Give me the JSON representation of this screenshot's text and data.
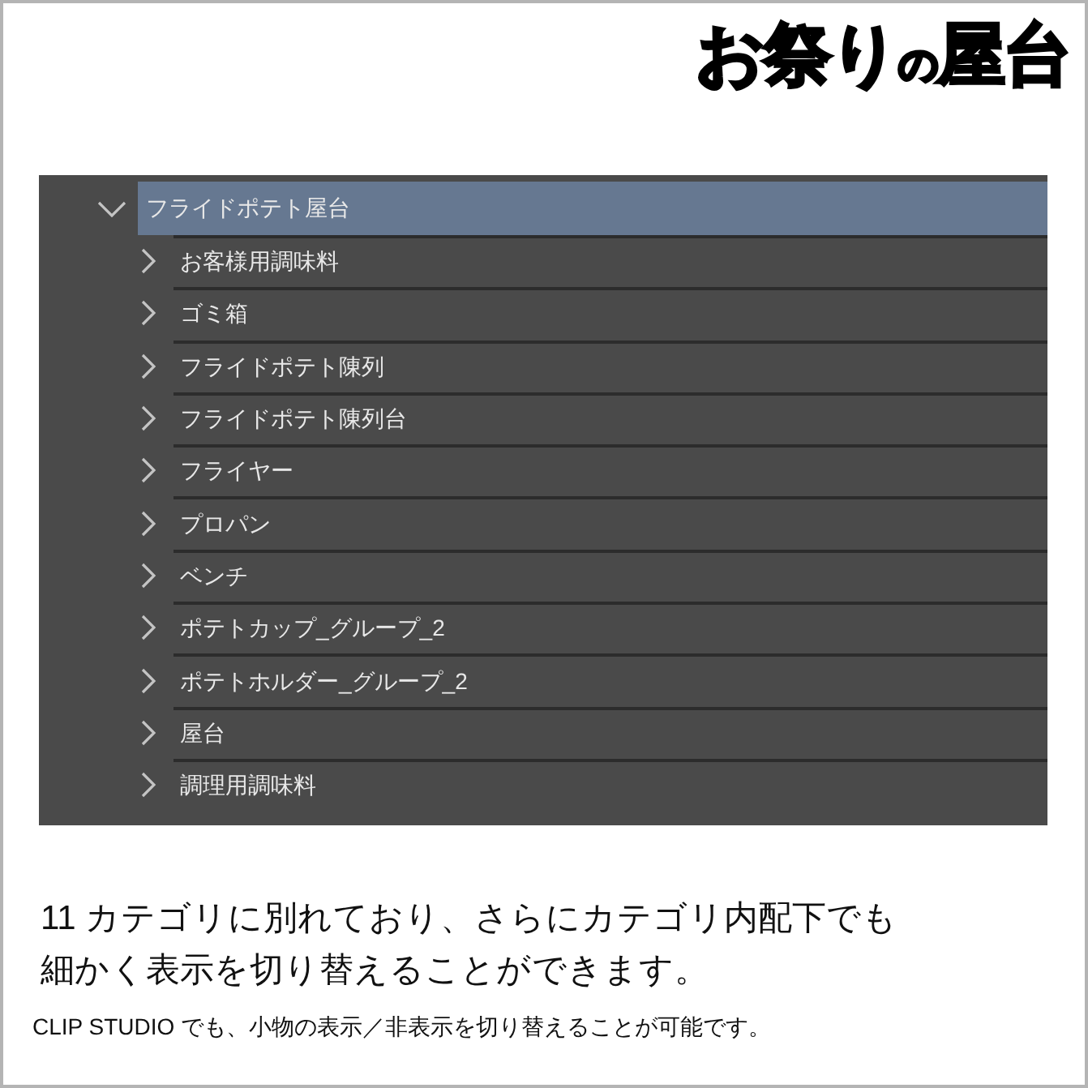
{
  "header": {
    "title": "お祭り$_{の}$屋台"
  },
  "tree": {
    "label": "フライドポテト屋台",
    "expanded": true,
    "selected": true,
    "children": [
      {
        "label": "お客様用調味料",
        "expanded": false,
        "selected": false
      },
      {
        "label": "ゴミ箱",
        "expanded": false,
        "selected": false
      },
      {
        "label": "フライドポテト陳列",
        "expanded": false,
        "selected": false
      },
      {
        "label": "フライドポテト陳列台",
        "expanded": false,
        "selected": false
      },
      {
        "label": "フライヤー",
        "expanded": false,
        "selected": false
      },
      {
        "label": "プロパン",
        "expanded": false,
        "selected": false
      },
      {
        "label": "ベンチ",
        "expanded": false,
        "selected": false
      },
      {
        "label": "ポテトカップ_グループ_2",
        "expanded": false,
        "selected": false
      },
      {
        "label": "ポテトホルダー_グループ_2",
        "expanded": false,
        "selected": false
      },
      {
        "label": "屋台",
        "expanded": false,
        "selected": false
      },
      {
        "label": "調理用調味料",
        "expanded": false,
        "selected": false
      }
    ]
  },
  "description": {
    "text": "11 カテゴリに別れており、さらにカテゴリ内配下でも細かく表示を切り替えることができます。",
    "note": "CLIP STUDIO でも、小物の表示／非表示を切り替えることが可能です。"
  }
}
